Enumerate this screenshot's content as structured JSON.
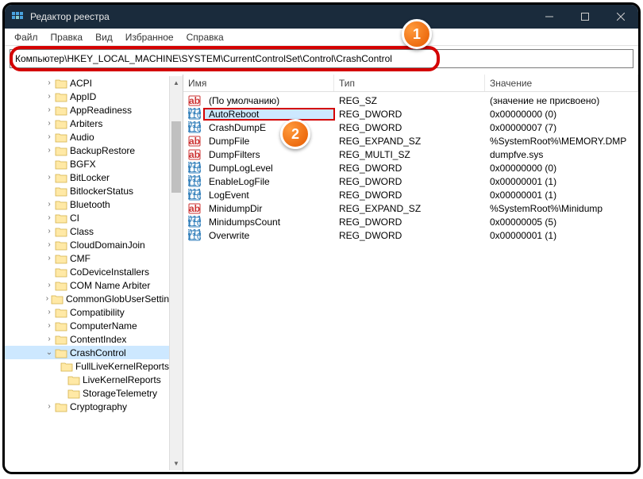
{
  "window": {
    "title": "Редактор реестра"
  },
  "menu": {
    "file": "Файл",
    "edit": "Правка",
    "view": "Вид",
    "favorites": "Избранное",
    "help": "Справка"
  },
  "address": {
    "value": "Компьютер\\HKEY_LOCAL_MACHINE\\SYSTEM\\CurrentControlSet\\Control\\CrashControl"
  },
  "cols": {
    "name": "Имя",
    "type": "Тип",
    "data": "Значение"
  },
  "tree": [
    {
      "label": "ACPI",
      "indent": 2,
      "exp": ">"
    },
    {
      "label": "AppID",
      "indent": 2,
      "exp": ">"
    },
    {
      "label": "AppReadiness",
      "indent": 2,
      "exp": ">"
    },
    {
      "label": "Arbiters",
      "indent": 2,
      "exp": ">"
    },
    {
      "label": "Audio",
      "indent": 2,
      "exp": ">"
    },
    {
      "label": "BackupRestore",
      "indent": 2,
      "exp": ">"
    },
    {
      "label": "BGFX",
      "indent": 2,
      "exp": ""
    },
    {
      "label": "BitLocker",
      "indent": 2,
      "exp": ">"
    },
    {
      "label": "BitlockerStatus",
      "indent": 2,
      "exp": ""
    },
    {
      "label": "Bluetooth",
      "indent": 2,
      "exp": ">"
    },
    {
      "label": "CI",
      "indent": 2,
      "exp": ">"
    },
    {
      "label": "Class",
      "indent": 2,
      "exp": ">"
    },
    {
      "label": "CloudDomainJoin",
      "indent": 2,
      "exp": ">"
    },
    {
      "label": "CMF",
      "indent": 2,
      "exp": ">"
    },
    {
      "label": "CoDeviceInstallers",
      "indent": 2,
      "exp": ""
    },
    {
      "label": "COM Name Arbiter",
      "indent": 2,
      "exp": ">"
    },
    {
      "label": "CommonGlobUserSettin",
      "indent": 2,
      "exp": ">"
    },
    {
      "label": "Compatibility",
      "indent": 2,
      "exp": ">"
    },
    {
      "label": "ComputerName",
      "indent": 2,
      "exp": ">"
    },
    {
      "label": "ContentIndex",
      "indent": 2,
      "exp": ">"
    },
    {
      "label": "CrashControl",
      "indent": 2,
      "exp": "v",
      "selected": true
    },
    {
      "label": "FullLiveKernelReports",
      "indent": 3,
      "exp": ""
    },
    {
      "label": "LiveKernelReports",
      "indent": 3,
      "exp": ""
    },
    {
      "label": "StorageTelemetry",
      "indent": 3,
      "exp": ""
    },
    {
      "label": "Cryptography",
      "indent": 2,
      "exp": ">"
    }
  ],
  "values": [
    {
      "icon": "ab",
      "name": "(По умолчанию)",
      "type": "REG_SZ",
      "data": "(значение не присвоено)"
    },
    {
      "icon": "bin",
      "name": "AutoReboot",
      "type": "REG_DWORD",
      "data": "0x00000000 (0)",
      "highlight": true,
      "selected": true
    },
    {
      "icon": "bin",
      "name": "CrashDumpE",
      "type": "REG_DWORD",
      "data": "0x00000007 (7)"
    },
    {
      "icon": "ab",
      "name": "DumpFile",
      "type": "REG_EXPAND_SZ",
      "data": "%SystemRoot%\\MEMORY.DMP"
    },
    {
      "icon": "ab",
      "name": "DumpFilters",
      "type": "REG_MULTI_SZ",
      "data": "dumpfve.sys"
    },
    {
      "icon": "bin",
      "name": "DumpLogLevel",
      "type": "REG_DWORD",
      "data": "0x00000000 (0)"
    },
    {
      "icon": "bin",
      "name": "EnableLogFile",
      "type": "REG_DWORD",
      "data": "0x00000001 (1)"
    },
    {
      "icon": "bin",
      "name": "LogEvent",
      "type": "REG_DWORD",
      "data": "0x00000001 (1)"
    },
    {
      "icon": "ab",
      "name": "MinidumpDir",
      "type": "REG_EXPAND_SZ",
      "data": "%SystemRoot%\\Minidump"
    },
    {
      "icon": "bin",
      "name": "MinidumpsCount",
      "type": "REG_DWORD",
      "data": "0x00000005 (5)"
    },
    {
      "icon": "bin",
      "name": "Overwrite",
      "type": "REG_DWORD",
      "data": "0x00000001 (1)"
    }
  ],
  "badges": {
    "b1": "1",
    "b2": "2"
  }
}
